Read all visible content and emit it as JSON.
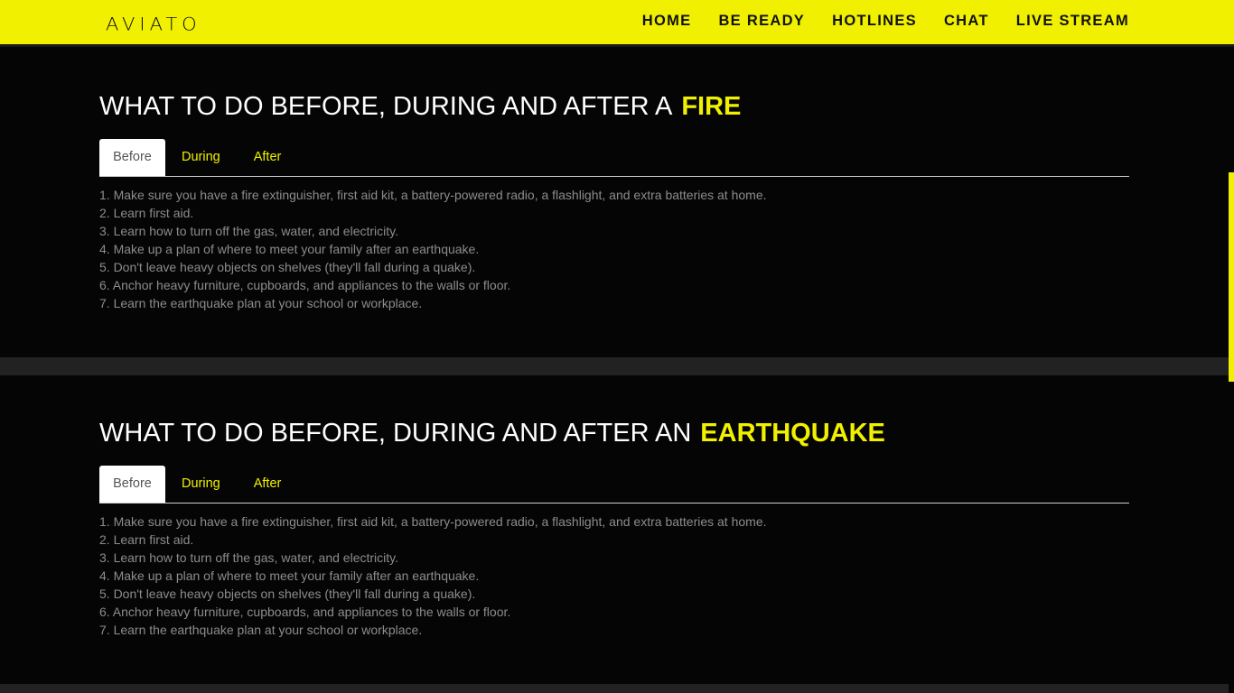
{
  "header": {
    "logo": "AVIATO",
    "nav": [
      "HOME",
      "BE READY",
      "HOTLINES",
      "CHAT",
      "LIVE STREAM"
    ]
  },
  "colors": {
    "accent": "#f0f000",
    "background": "#050505",
    "text_muted": "#8c8c8c",
    "heading": "#ffffff"
  },
  "sections": [
    {
      "title_prefix": "WHAT TO DO BEFORE, DURING AND AFTER A",
      "title_highlight": "FIRE",
      "tabs": [
        "Before",
        "During",
        "After"
      ],
      "active_tab": "Before",
      "items": [
        "1. Make sure you have a fire extinguisher, first aid kit, a battery-powered radio, a flashlight, and extra batteries at home.",
        "2. Learn first aid.",
        "3. Learn how to turn off the gas, water, and electricity.",
        "4. Make up a plan of where to meet your family after an earthquake.",
        "5. Don't leave heavy objects on shelves (they'll fall during a quake).",
        "6. Anchor heavy furniture, cupboards, and appliances to the walls or floor.",
        "7. Learn the earthquake plan at your school or workplace."
      ]
    },
    {
      "title_prefix": "WHAT TO DO BEFORE, DURING AND AFTER AN",
      "title_highlight": "EARTHQUAKE",
      "tabs": [
        "Before",
        "During",
        "After"
      ],
      "active_tab": "Before",
      "items": [
        "1. Make sure you have a fire extinguisher, first aid kit, a battery-powered radio, a flashlight, and extra batteries at home.",
        "2. Learn first aid.",
        "3. Learn how to turn off the gas, water, and electricity.",
        "4. Make up a plan of where to meet your family after an earthquake.",
        "5. Don't leave heavy objects on shelves (they'll fall during a quake).",
        "6. Anchor heavy furniture, cupboards, and appliances to the walls or floor.",
        "7. Learn the earthquake plan at your school or workplace."
      ]
    }
  ]
}
